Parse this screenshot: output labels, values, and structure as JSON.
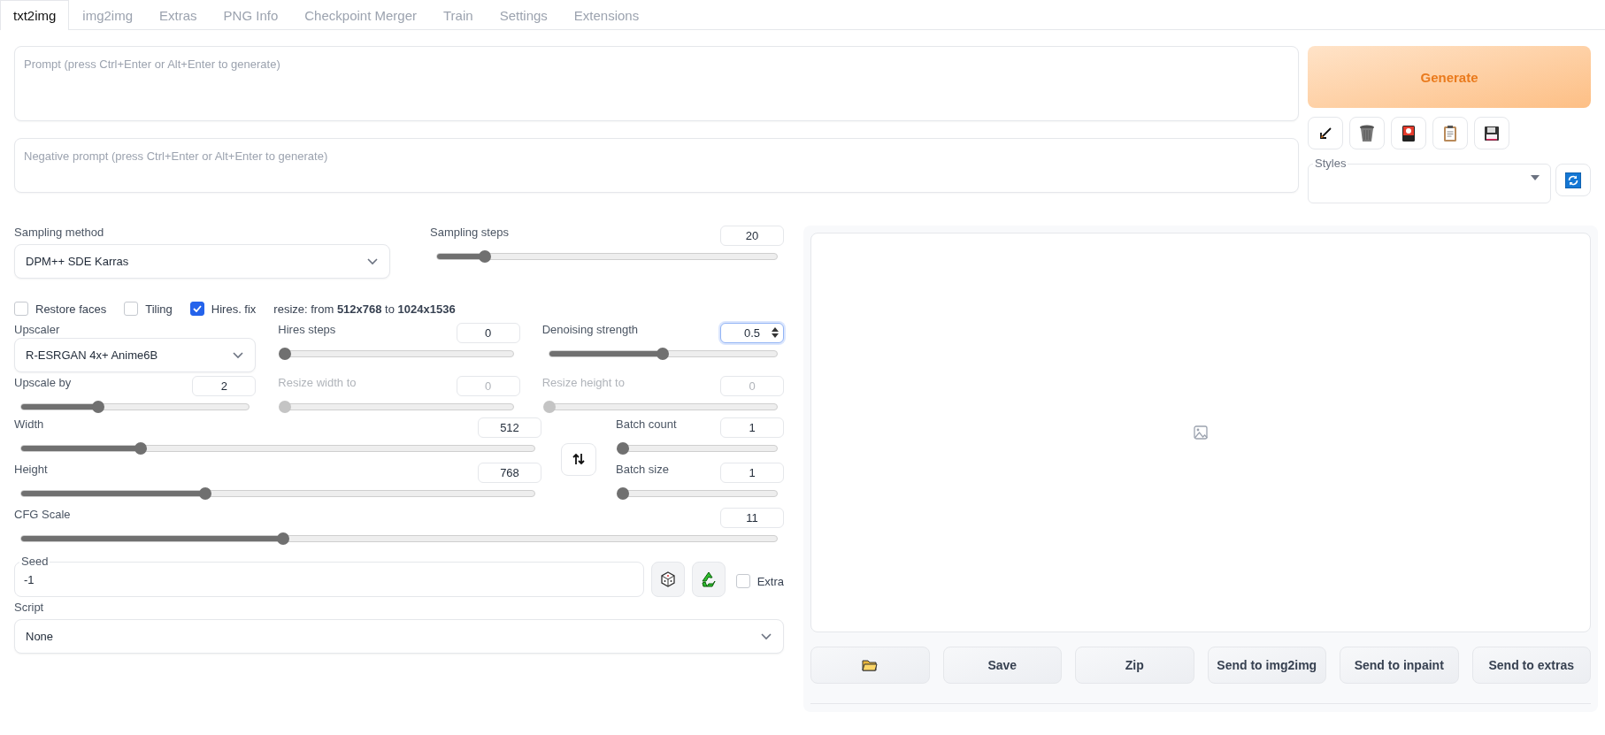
{
  "tabs": [
    {
      "label": "txt2img",
      "selected": true
    },
    {
      "label": "img2img",
      "selected": false
    },
    {
      "label": "Extras",
      "selected": false
    },
    {
      "label": "PNG Info",
      "selected": false
    },
    {
      "label": "Checkpoint Merger",
      "selected": false
    },
    {
      "label": "Train",
      "selected": false
    },
    {
      "label": "Settings",
      "selected": false
    },
    {
      "label": "Extensions",
      "selected": false
    }
  ],
  "prompt": {
    "placeholder": "Prompt (press Ctrl+Enter or Alt+Enter to generate)"
  },
  "negative_prompt": {
    "placeholder": "Negative prompt (press Ctrl+Enter or Alt+Enter to generate)"
  },
  "generate_button": "Generate",
  "styles": {
    "label": "Styles"
  },
  "sampling_method": {
    "label": "Sampling method",
    "value": "DPM++ SDE Karras"
  },
  "sampling_steps": {
    "label": "Sampling steps",
    "value": "20",
    "level": 0.14,
    "disabled": false,
    "focused": false
  },
  "checkboxes": [
    {
      "label": "Restore faces",
      "checked": false
    },
    {
      "label": "Tiling",
      "checked": false
    },
    {
      "label": "Hires. fix",
      "checked": true
    }
  ],
  "resize_note": "resize: from **512x768** to **1024x1536**",
  "upscaler": {
    "label": "Upscaler",
    "value": "R-ESRGAN 4x+ Anime6B"
  },
  "hires_sliders": [
    {
      "label": "Hires steps",
      "value": "0",
      "level": 0,
      "disabled": false,
      "focused": false
    },
    {
      "label": "Denoising strength",
      "value": "0.5",
      "level": 0.5,
      "disabled": false,
      "focused": true
    },
    {
      "label": "Upscale by",
      "value": "2",
      "level": 0.34,
      "disabled": false,
      "focused": false
    },
    {
      "label": "Resize width to",
      "value": "0",
      "level": 0,
      "disabled": true,
      "focused": false
    },
    {
      "label": "Resize height to",
      "value": "0",
      "level": 0,
      "disabled": true,
      "focused": false
    }
  ],
  "size_sliders": [
    {
      "label": "Width",
      "value": "512",
      "level": 0.233,
      "disabled": false,
      "focused": false
    },
    {
      "label": "Height",
      "value": "768",
      "level": 0.358,
      "disabled": false,
      "focused": false
    }
  ],
  "batch_sliders": [
    {
      "label": "Batch count",
      "value": "1",
      "level": 0,
      "disabled": false,
      "focused": false
    },
    {
      "label": "Batch size",
      "value": "1",
      "level": 0,
      "disabled": false,
      "focused": false
    }
  ],
  "cfg_scale": {
    "label": "CFG Scale",
    "value": "11",
    "level": 0.347,
    "disabled": false,
    "focused": false
  },
  "seed": {
    "label": "Seed",
    "value": "-1",
    "extra": {
      "label": "Extra",
      "checked": false
    }
  },
  "script": {
    "label": "Script",
    "value": "None"
  },
  "gallery_buttons": [
    {
      "kind": "folder"
    },
    {
      "kind": "text",
      "label": "Save"
    },
    {
      "kind": "text",
      "label": "Zip"
    },
    {
      "kind": "text",
      "label": "Send to img2img"
    },
    {
      "kind": "text",
      "label": "Send to inpaint"
    },
    {
      "kind": "text",
      "label": "Send to extras"
    }
  ]
}
